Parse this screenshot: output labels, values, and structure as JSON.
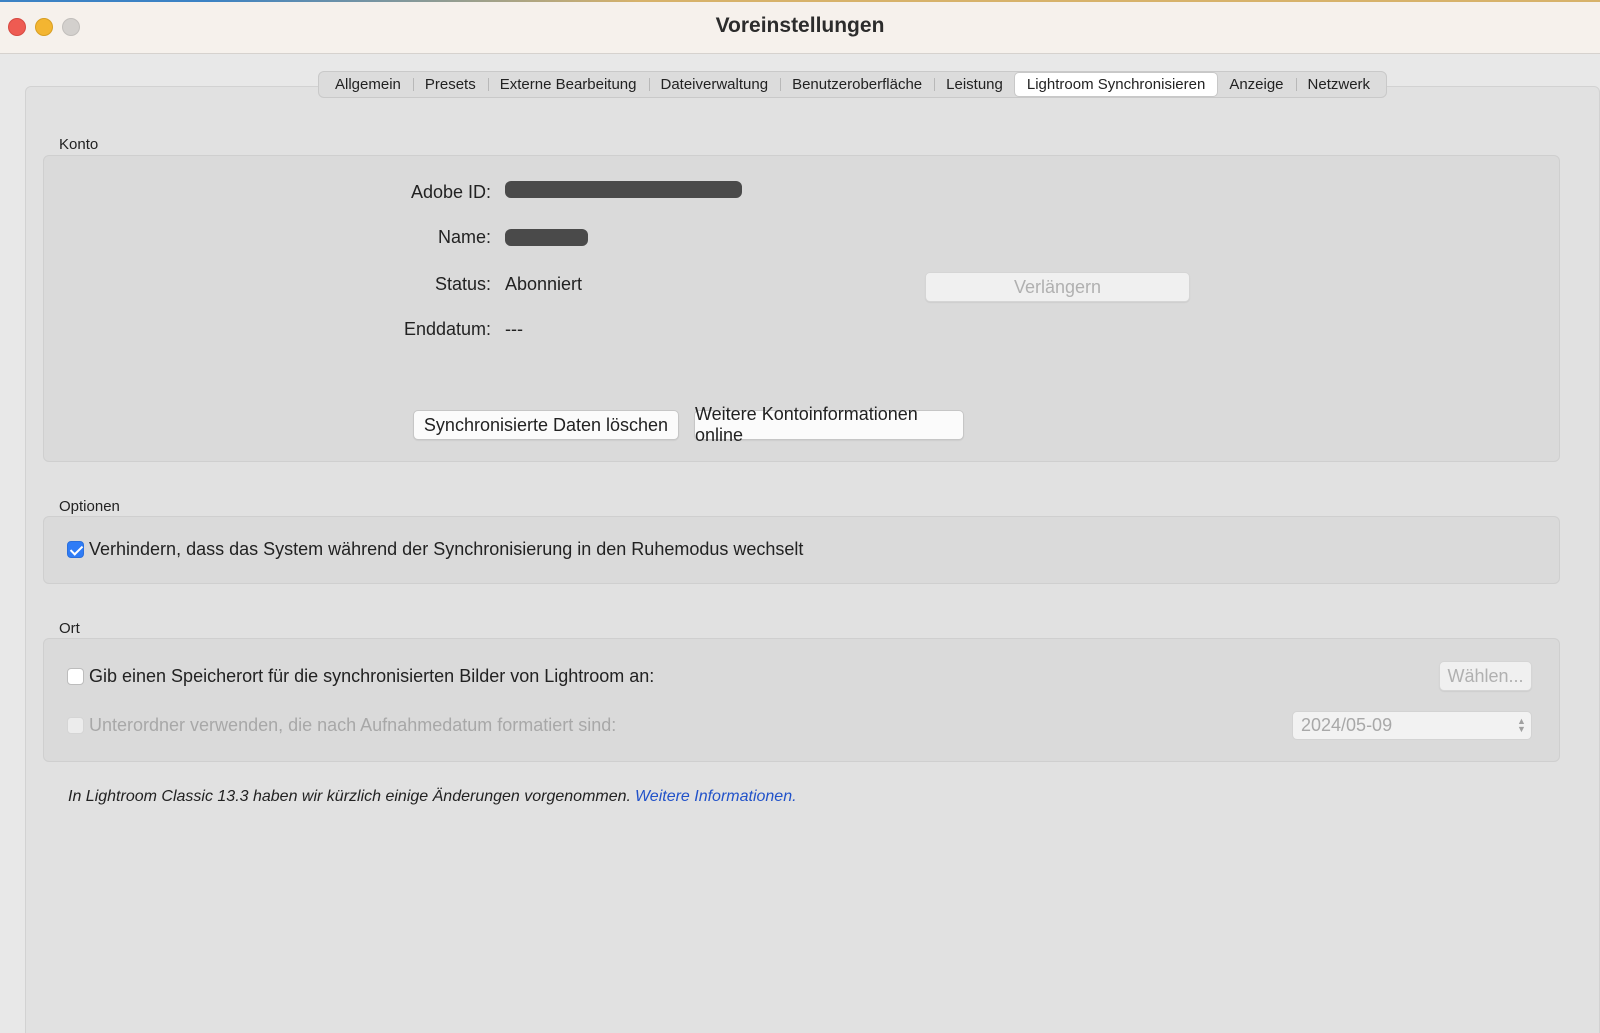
{
  "window": {
    "title": "Voreinstellungen"
  },
  "tabs": [
    {
      "label": "Allgemein"
    },
    {
      "label": "Presets"
    },
    {
      "label": "Externe Bearbeitung"
    },
    {
      "label": "Dateiverwaltung"
    },
    {
      "label": "Benutzeroberfläche"
    },
    {
      "label": "Leistung"
    },
    {
      "label": "Lightroom Synchronisieren",
      "active": true
    },
    {
      "label": "Anzeige"
    },
    {
      "label": "Netzwerk"
    }
  ],
  "konto": {
    "section_label": "Konto",
    "adobe_id_label": "Adobe ID:",
    "name_label": "Name:",
    "status_label": "Status:",
    "status_value": "Abonniert",
    "enddatum_label": "Enddatum:",
    "enddatum_value": "---",
    "renew_button": "Verlängern",
    "delete_button": "Synchronisierte Daten löschen",
    "more_info_button": "Weitere Kontoinformationen online"
  },
  "optionen": {
    "section_label": "Optionen",
    "prevent_sleep_label": "Verhindern, dass das System während der Synchronisierung in den Ruhemodus wechselt",
    "prevent_sleep_checked": true
  },
  "ort": {
    "section_label": "Ort",
    "location_label": "Gib einen Speicherort für die synchronisierten Bilder von Lightroom an:",
    "location_checked": false,
    "choose_button": "Wählen...",
    "subfolder_label": "Unterordner verwenden, die nach Aufnahmedatum formatiert sind:",
    "subfolder_checked": false,
    "date_format_value": "2024/05-09"
  },
  "footnote": {
    "text": "In Lightroom Classic 13.3 haben wir kürzlich einige Änderungen vorgenommen.",
    "link": "Weitere Informationen."
  },
  "colors": {
    "accent": "#2f7cf6",
    "link": "#2152c9",
    "close": "#ee5b52",
    "minimize": "#f3b531"
  }
}
